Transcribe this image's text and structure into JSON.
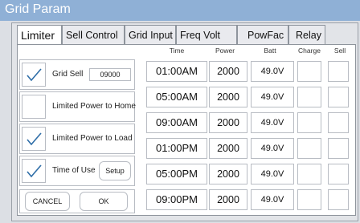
{
  "window": {
    "title": "Grid Param"
  },
  "tabs": [
    {
      "label": "Limiter",
      "active": true
    },
    {
      "label": "Sell Control",
      "active": false
    },
    {
      "label": "Grid Input",
      "active": false
    },
    {
      "label": "Freq Volt",
      "active": false
    },
    {
      "label": "PowFac",
      "active": false
    },
    {
      "label": "Relay",
      "active": false
    }
  ],
  "options": {
    "grid_sell": {
      "label": "Grid Sell",
      "checked": true,
      "value": "09000"
    },
    "limited_home": {
      "label": "Limited Power to Home",
      "checked": false
    },
    "limited_load": {
      "label": "Limited Power to Load",
      "checked": true
    },
    "time_of_use": {
      "label": "Time of Use",
      "checked": true,
      "setup_label": "Setup"
    }
  },
  "buttons": {
    "cancel": "CANCEL",
    "ok": "OK"
  },
  "schedule": {
    "headers": [
      "Time",
      "Power",
      "Batt",
      "Charge",
      "Sell"
    ],
    "rows": [
      {
        "time": "01:00AM",
        "power": "2000",
        "batt": "49.0V"
      },
      {
        "time": "05:00AM",
        "power": "2000",
        "batt": "49.0V"
      },
      {
        "time": "09:00AM",
        "power": "2000",
        "batt": "49.0V"
      },
      {
        "time": "01:00PM",
        "power": "2000",
        "batt": "49.0V"
      },
      {
        "time": "05:00PM",
        "power": "2000",
        "batt": "49.0V"
      },
      {
        "time": "09:00PM",
        "power": "2000",
        "batt": "49.0V"
      }
    ]
  },
  "colors": {
    "titlebar": "#8fb0d6",
    "background": "#dcdfe4",
    "check": "#2f6ea8"
  }
}
